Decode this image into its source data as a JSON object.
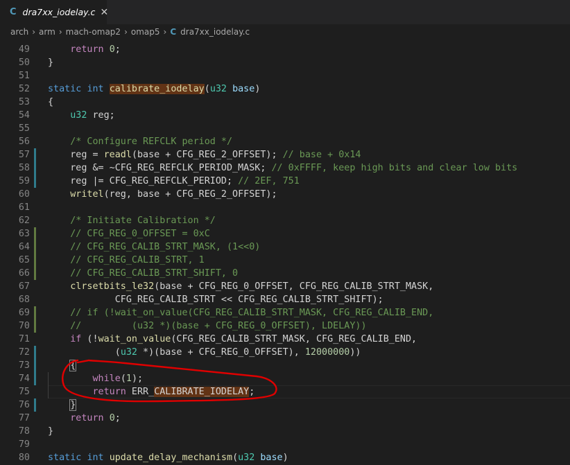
{
  "tab": {
    "icon": "C",
    "title": "dra7xx_iodelay.c",
    "close": "✕"
  },
  "breadcrumb": {
    "items": [
      "arch",
      "arm",
      "mach-omap2",
      "omap5"
    ],
    "file_icon": "C",
    "file": "dra7xx_iodelay.c",
    "separator": "›"
  },
  "colors": {
    "added": "#2f7c8c",
    "modified": "#617a40",
    "annotation": "#e00000",
    "highlight": "#623315"
  },
  "lines": [
    {
      "n": "49",
      "text": "    return 0;"
    },
    {
      "n": "50",
      "text": "}"
    },
    {
      "n": "51",
      "text": ""
    },
    {
      "n": "52",
      "text": "static int calibrate_iodelay(u32 base)"
    },
    {
      "n": "53",
      "text": "{"
    },
    {
      "n": "54",
      "text": "    u32 reg;"
    },
    {
      "n": "55",
      "text": ""
    },
    {
      "n": "56",
      "text": "    /* Configure REFCLK period */"
    },
    {
      "n": "57",
      "text": "    reg = readl(base + CFG_REG_2_OFFSET); // base + 0x14",
      "mark": "added"
    },
    {
      "n": "58",
      "text": "    reg &= ~CFG_REG_REFCLK_PERIOD_MASK; // 0xFFFF, keep high bits and clear low bits",
      "mark": "added"
    },
    {
      "n": "59",
      "text": "    reg |= CFG_REG_REFCLK_PERIOD; // 2EF, 751",
      "mark": "added"
    },
    {
      "n": "60",
      "text": "    writel(reg, base + CFG_REG_2_OFFSET);"
    },
    {
      "n": "61",
      "text": ""
    },
    {
      "n": "62",
      "text": "    /* Initiate Calibration */"
    },
    {
      "n": "63",
      "text": "    // CFG_REG_0_OFFSET = 0xC",
      "mark": "modified"
    },
    {
      "n": "64",
      "text": "    // CFG_REG_CALIB_STRT_MASK, (1<<0)",
      "mark": "modified"
    },
    {
      "n": "65",
      "text": "    // CFG_REG_CALIB_STRT, 1",
      "mark": "modified"
    },
    {
      "n": "66",
      "text": "    // CFG_REG_CALIB_STRT_SHIFT, 0",
      "mark": "modified"
    },
    {
      "n": "67",
      "text": "    clrsetbits_le32(base + CFG_REG_0_OFFSET, CFG_REG_CALIB_STRT_MASK,"
    },
    {
      "n": "68",
      "text": "            CFG_REG_CALIB_STRT << CFG_REG_CALIB_STRT_SHIFT);"
    },
    {
      "n": "69",
      "text": "    // if (!wait_on_value(CFG_REG_CALIB_STRT_MASK, CFG_REG_CALIB_END,",
      "mark": "modified"
    },
    {
      "n": "70",
      "text": "    //         (u32 *)(base + CFG_REG_0_OFFSET), LDELAY))",
      "mark": "modified"
    },
    {
      "n": "71",
      "text": "    if (!wait_on_value(CFG_REG_CALIB_STRT_MASK, CFG_REG_CALIB_END,"
    },
    {
      "n": "72",
      "text": "            (u32 *)(base + CFG_REG_0_OFFSET), 12000000))",
      "mark": "added"
    },
    {
      "n": "73",
      "text": "    {",
      "mark": "added"
    },
    {
      "n": "74",
      "text": "        while(1);",
      "mark": "added"
    },
    {
      "n": "75",
      "text": "        return ERR_CALIBRATE_IODELAY;"
    },
    {
      "n": "76",
      "text": "    }",
      "mark": "added"
    },
    {
      "n": "77",
      "text": "    return 0;"
    },
    {
      "n": "78",
      "text": "}"
    },
    {
      "n": "79",
      "text": ""
    },
    {
      "n": "80",
      "text": "static int update_delay_mechanism(u32 base)"
    }
  ]
}
